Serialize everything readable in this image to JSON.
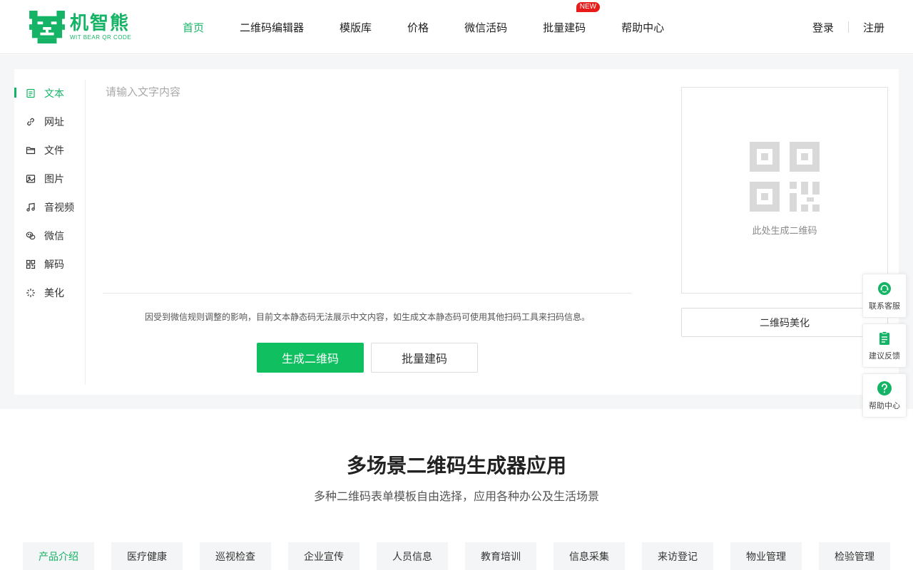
{
  "brand": {
    "name_cn": "机智熊",
    "name_en": "WIT BEAR QR CODE",
    "color": "#15b365"
  },
  "nav": {
    "items": [
      {
        "label": "首页",
        "active": true
      },
      {
        "label": "二维码编辑器"
      },
      {
        "label": "模版库"
      },
      {
        "label": "价格"
      },
      {
        "label": "微信活码"
      },
      {
        "label": "批量建码",
        "badge": "NEW"
      },
      {
        "label": "帮助中心"
      }
    ]
  },
  "auth": {
    "login": "登录",
    "register": "注册"
  },
  "sidebar": {
    "items": [
      {
        "label": "文本",
        "icon": "document-icon",
        "active": true
      },
      {
        "label": "网址",
        "icon": "link-icon"
      },
      {
        "label": "文件",
        "icon": "folder-icon"
      },
      {
        "label": "图片",
        "icon": "image-icon"
      },
      {
        "label": "音视频",
        "icon": "music-icon"
      },
      {
        "label": "微信",
        "icon": "wechat-icon"
      },
      {
        "label": "解码",
        "icon": "qr-scan-icon"
      },
      {
        "label": "美化",
        "icon": "sparkle-icon"
      }
    ]
  },
  "editor": {
    "placeholder": "请输入文字内容",
    "value": "",
    "notice": "因受到微信规则调整的影响，目前文本静态码无法展示中文内容，如生成文本静态码可使用其他扫码工具来扫码信息。",
    "generate_label": "生成二维码",
    "batch_label": "批量建码"
  },
  "preview": {
    "hint": "此处生成二维码",
    "beautify_label": "二维码美化"
  },
  "float_tools": [
    {
      "label": "联系客服",
      "icon": "customer-service-icon"
    },
    {
      "label": "建议反馈",
      "icon": "clipboard-icon"
    },
    {
      "label": "帮助中心",
      "icon": "help-icon"
    }
  ],
  "section": {
    "title": "多场景二维码生成器应用",
    "subtitle": "多种二维码表单模板自由选择，应用各种办公及生活场景",
    "categories": [
      {
        "label": "产品介绍",
        "active": true
      },
      {
        "label": "医疗健康"
      },
      {
        "label": "巡视检查"
      },
      {
        "label": "企业宣传"
      },
      {
        "label": "人员信息"
      },
      {
        "label": "教育培训"
      },
      {
        "label": "信息采集"
      },
      {
        "label": "来访登记"
      },
      {
        "label": "物业管理"
      },
      {
        "label": "检验管理"
      }
    ]
  }
}
